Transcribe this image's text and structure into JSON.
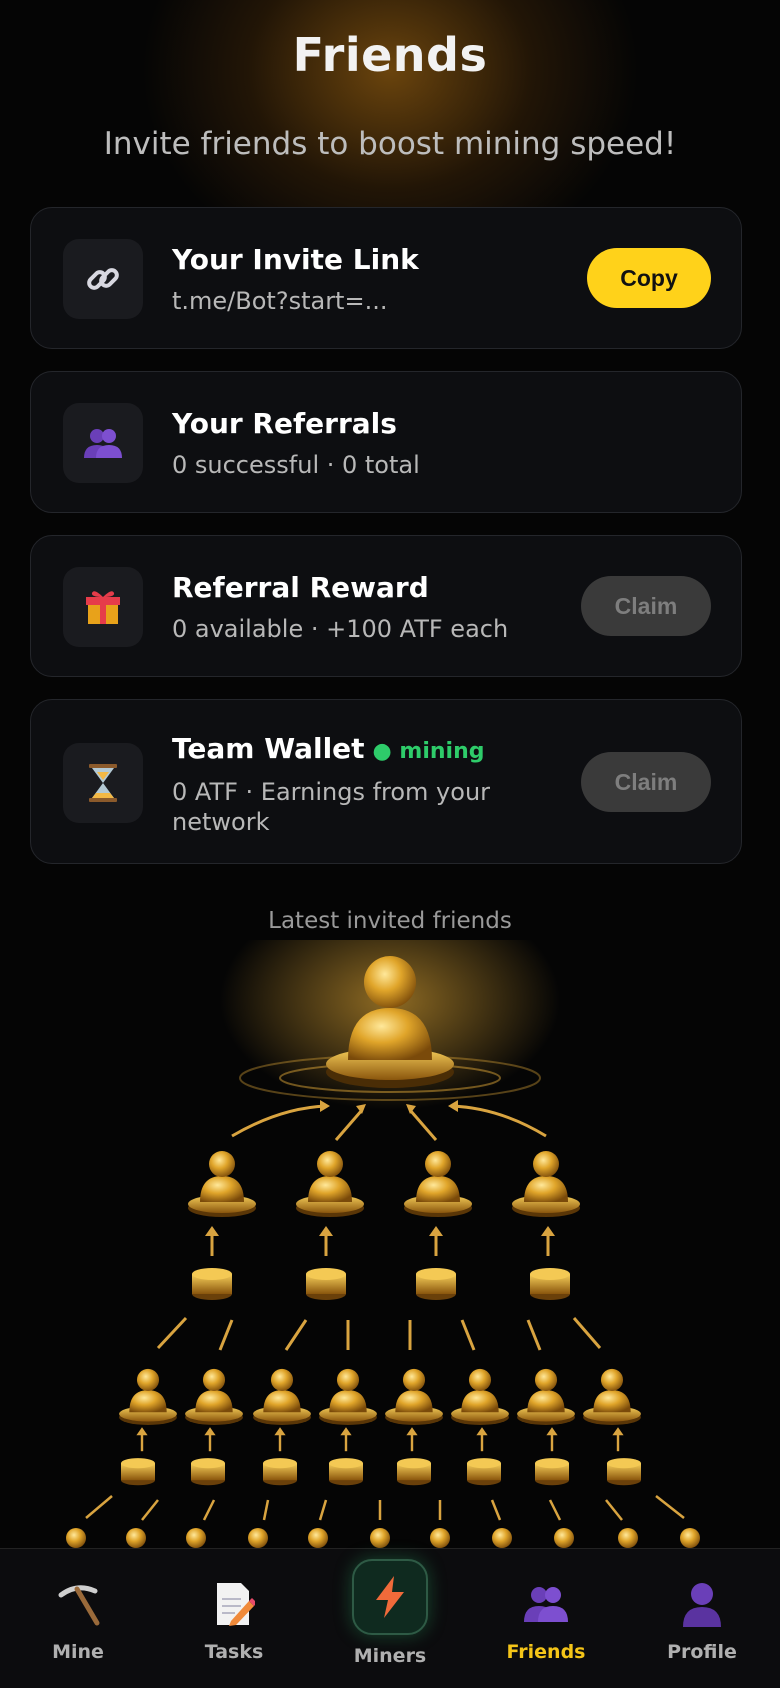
{
  "header": {
    "title": "Friends",
    "subtitle": "Invite friends to boost mining speed!"
  },
  "invite_card": {
    "title": "Your Invite Link",
    "link": "t.me/Bot?start=...",
    "copy_label": "Copy",
    "icon": "link-icon"
  },
  "referrals_card": {
    "title": "Your Referrals",
    "stats": "0 successful · 0 total",
    "icon": "people-icon"
  },
  "reward_card": {
    "title": "Referral Reward",
    "stats": "0 available · +100 ATF each",
    "claim_label": "Claim",
    "icon": "gift-icon"
  },
  "team_wallet_card": {
    "title": "Team Wallet",
    "status": "● mining",
    "description": "0 ATF · Earnings from your network",
    "claim_label": "Claim",
    "icon": "hourglass-icon"
  },
  "latest_label": "Latest invited friends",
  "nav": {
    "items": [
      {
        "label": "Mine",
        "icon": "pickaxe-icon"
      },
      {
        "label": "Tasks",
        "icon": "memo-icon"
      },
      {
        "label": "Miners",
        "icon": "lightning-icon"
      },
      {
        "label": "Friends",
        "icon": "people-icon",
        "active": true
      },
      {
        "label": "Profile",
        "icon": "person-icon"
      }
    ]
  },
  "colors": {
    "accent_yellow": "#ffd21a",
    "active_nav": "#f5c518",
    "mining_green": "#2ecc6a",
    "card_bg": "#0d0e11"
  }
}
